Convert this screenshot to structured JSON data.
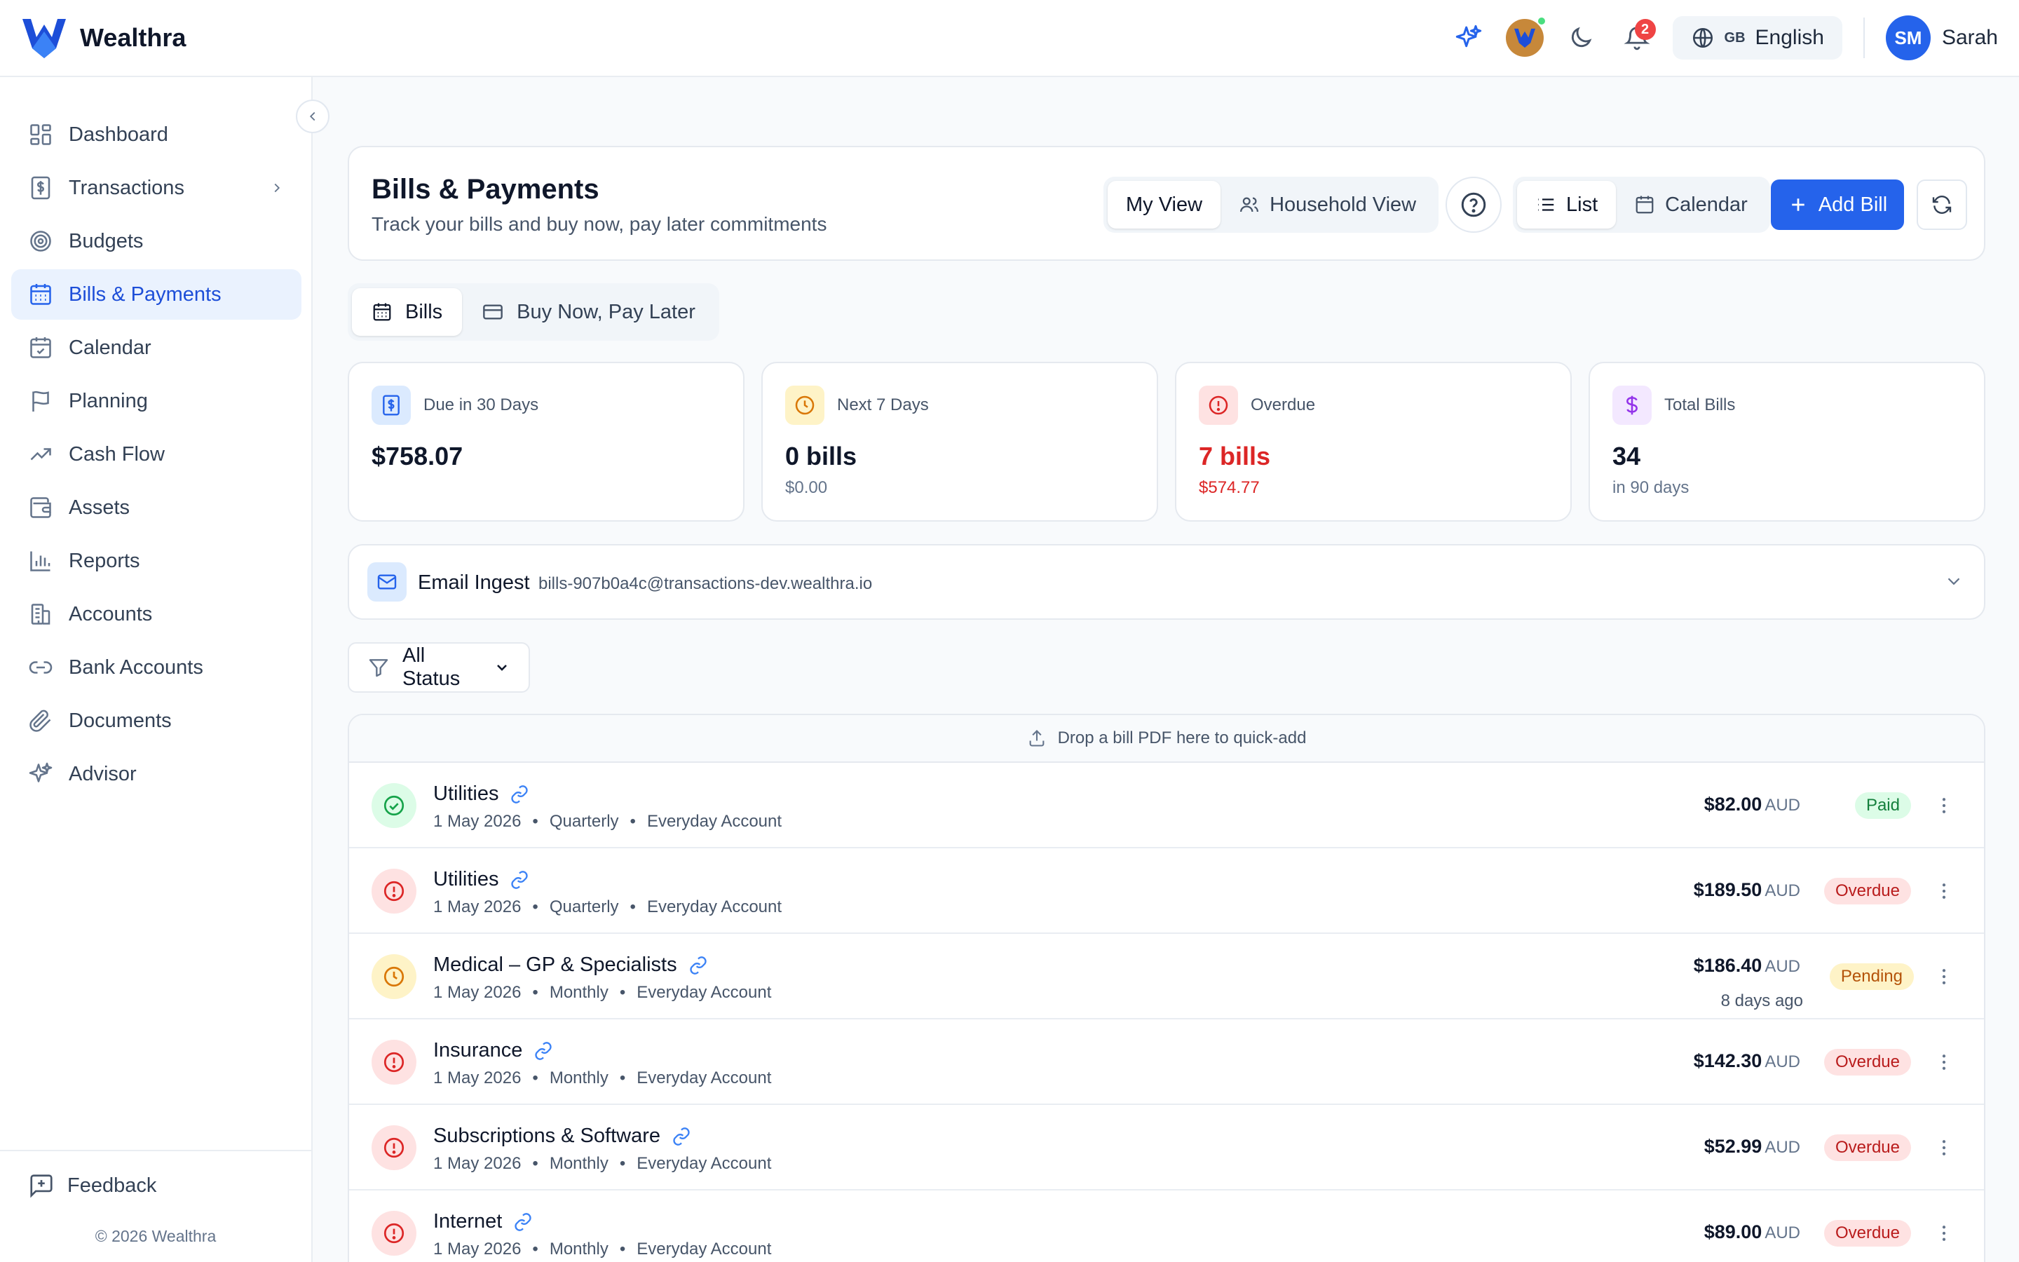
{
  "app": {
    "name": "Wealthra"
  },
  "header": {
    "notifications_count": "2",
    "language": {
      "flag": "GB",
      "label": "English"
    },
    "user": {
      "initials": "SM",
      "name": "Sarah"
    },
    "icons": [
      "sparkle-icon",
      "avatar-logo",
      "moon-icon",
      "bell-icon",
      "globe-icon"
    ]
  },
  "sidebar": {
    "items": [
      {
        "label": "Dashboard",
        "icon": "dashboard-icon"
      },
      {
        "label": "Transactions",
        "icon": "dollar-doc-icon",
        "has_children": true
      },
      {
        "label": "Budgets",
        "icon": "target-icon"
      },
      {
        "label": "Bills & Payments",
        "icon": "calendar-icon",
        "active": true
      },
      {
        "label": "Calendar",
        "icon": "calendar-check-icon"
      },
      {
        "label": "Planning",
        "icon": "flag-icon"
      },
      {
        "label": "Cash Flow",
        "icon": "trend-up-icon"
      },
      {
        "label": "Assets",
        "icon": "wallet-icon"
      },
      {
        "label": "Reports",
        "icon": "bar-chart-icon"
      },
      {
        "label": "Accounts",
        "icon": "building-icon"
      },
      {
        "label": "Bank Accounts",
        "icon": "link-icon"
      },
      {
        "label": "Documents",
        "icon": "paperclip-icon"
      },
      {
        "label": "Advisor",
        "icon": "sparkle-icon"
      }
    ],
    "feedback": "Feedback",
    "copyright": "© 2026 Wealthra"
  },
  "page": {
    "title": "Bills & Payments",
    "subtitle": "Track your bills and buy now, pay later commitments",
    "view_toggle": {
      "my_view": "My View",
      "household_view": "Household View"
    },
    "layout_toggle": {
      "list": "List",
      "calendar": "Calendar"
    },
    "add_bill": "Add Bill"
  },
  "tabs": {
    "bills": "Bills",
    "bnpl": "Buy Now, Pay Later"
  },
  "stats": [
    {
      "label": "Due in 30 Days",
      "value": "$758.07",
      "sub": "",
      "color": "#2563eb"
    },
    {
      "label": "Next 7 Days",
      "value": "0 bills",
      "sub": "$0.00",
      "color": "#d97706"
    },
    {
      "label": "Overdue",
      "value": "7 bills",
      "sub": "$574.77",
      "color": "#dc2626"
    },
    {
      "label": "Total Bills",
      "value": "34",
      "sub": "in 90 days",
      "color": "#9333ea"
    }
  ],
  "email_ingest": {
    "label": "Email Ingest",
    "address": "bills-907b0a4c@transactions-dev.wealthra.io"
  },
  "filter": {
    "label": "All Status"
  },
  "dropzone": {
    "label": "Drop a bill PDF here to quick-add"
  },
  "bills": [
    {
      "name": "Utilities",
      "date": "1 May 2026",
      "freq": "Quarterly",
      "account": "Everyday Account",
      "amount": "$82.00",
      "currency": "AUD",
      "status": "Paid",
      "ago": ""
    },
    {
      "name": "Utilities",
      "date": "1 May 2026",
      "freq": "Quarterly",
      "account": "Everyday Account",
      "amount": "$189.50",
      "currency": "AUD",
      "status": "Overdue",
      "ago": ""
    },
    {
      "name": "Medical – GP & Specialists",
      "date": "1 May 2026",
      "freq": "Monthly",
      "account": "Everyday Account",
      "amount": "$186.40",
      "currency": "AUD",
      "status": "Pending",
      "ago": "8 days ago"
    },
    {
      "name": "Insurance",
      "date": "1 May 2026",
      "freq": "Monthly",
      "account": "Everyday Account",
      "amount": "$142.30",
      "currency": "AUD",
      "status": "Overdue",
      "ago": ""
    },
    {
      "name": "Subscriptions & Software",
      "date": "1 May 2026",
      "freq": "Monthly",
      "account": "Everyday Account",
      "amount": "$52.99",
      "currency": "AUD",
      "status": "Overdue",
      "ago": ""
    },
    {
      "name": "Internet",
      "date": "1 May 2026",
      "freq": "Monthly",
      "account": "Everyday Account",
      "amount": "$89.00",
      "currency": "AUD",
      "status": "Overdue",
      "ago": ""
    }
  ],
  "separator": "•",
  "colors": {
    "primary": "#2563eb",
    "paid": "#16a34a",
    "overdue": "#dc2626",
    "pending": "#d97706"
  }
}
